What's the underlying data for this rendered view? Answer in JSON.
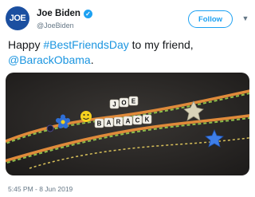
{
  "author": {
    "avatar_text": "JOE",
    "name": "Joe Biden",
    "handle": "@JoeBiden",
    "verified_icon": "verified-badge-icon"
  },
  "actions": {
    "follow_label": "Follow",
    "more_icon": "chevron-down-icon"
  },
  "tweet": {
    "line1_prefix": "Happy ",
    "hashtag": "#BestFriendsDay",
    "line1_suffix": " to my friend,",
    "mention": "@BarackObama",
    "mention_suffix": ".",
    "timestamp": "5:45 PM - 8 Jun 2019"
  },
  "photo": {
    "bead_words": [
      "JOE",
      "BARACK"
    ],
    "colors": {
      "background": "#2b2927",
      "thread_orange": "#e08a3a",
      "thread_green": "#8fbf4a"
    }
  },
  "colors": {
    "accent": "#1da1f2",
    "link": "#1b95e0",
    "muted": "#657786",
    "avatar_bg": "#1b4fa0"
  }
}
